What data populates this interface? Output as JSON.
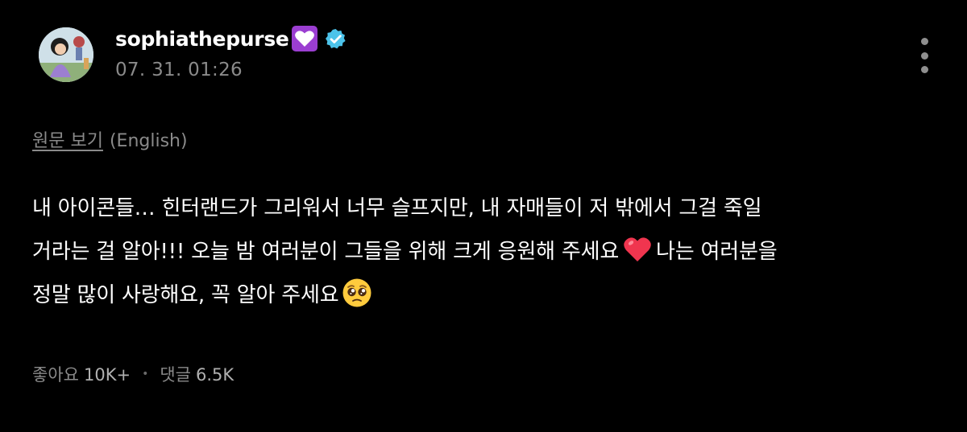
{
  "post": {
    "author": {
      "username": "sophiathepurse",
      "name_emoji": "purple-heart-box-emoji",
      "verified_badge": "verified-icon"
    },
    "timestamp": "07. 31. 01:26",
    "translation": {
      "view_original": "원문 보기",
      "language": "(English)"
    },
    "body": {
      "line1": "내 아이콘들… 힌터랜드가 그리워서 너무 슬프지만, 내 자매들이 저 밖에서 그걸 죽일",
      "line2_before_emoji": "거라는 걸 알아!!! 오늘 밤 여러분이 그들을 위해 크게 응원해 주세요",
      "line2_emoji": "red-heart-emoji",
      "line2_after_emoji": "나는 여러분을",
      "line3": "정말 많이 사랑해요, 꼭 알아 주세요",
      "line3_emoji": "pleading-face-emoji"
    },
    "stats": {
      "likes_label": "좋아요",
      "likes_value": "10K+",
      "separator": "•",
      "comments_label": "댓글",
      "comments_value": "6.5K"
    },
    "more_menu": "more-vertical-icon"
  },
  "colors": {
    "background": "#000000",
    "text_primary": "#ffffff",
    "text_secondary": "#8a8a8a",
    "verified": "#4cc3ea",
    "heart_box": "#9b3ed1",
    "red_heart": "#f0354f"
  }
}
